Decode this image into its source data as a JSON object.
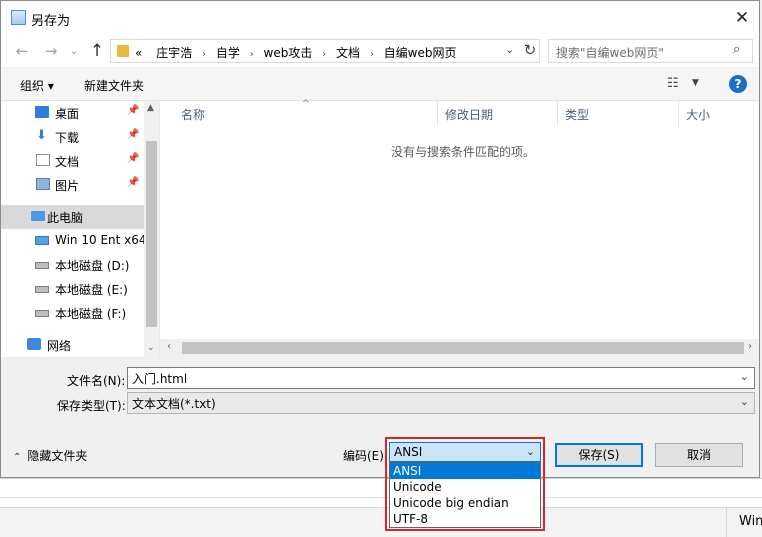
{
  "dialog": {
    "title": "另存为",
    "close_label": "✕"
  },
  "nav": {
    "back": "←",
    "forward": "→",
    "recent": "⌄",
    "up": "↑",
    "breadcrumb_prefix": "«",
    "breadcrumbs": [
      "庄宇浩",
      "自学",
      "web攻击",
      "文档",
      "自编web网页"
    ],
    "search_placeholder": "搜索\"自编web网页\""
  },
  "toolbar": {
    "organize": "组织 ▾",
    "new_folder": "新建文件夹",
    "help": "?"
  },
  "sidebar": {
    "items": [
      {
        "label": "桌面",
        "icon": "desktop-icon",
        "pinned": true
      },
      {
        "label": "下载",
        "icon": "download-icon",
        "pinned": true
      },
      {
        "label": "文档",
        "icon": "document-icon",
        "pinned": true
      },
      {
        "label": "图片",
        "icon": "pictures-icon",
        "pinned": true
      },
      {
        "label": "此电脑",
        "icon": "computer-icon",
        "selected": true
      },
      {
        "label": "Win 10 Ent x64",
        "icon": "system-drive-icon"
      },
      {
        "label": "本地磁盘 (D:)",
        "icon": "drive-icon"
      },
      {
        "label": "本地磁盘 (E:)",
        "icon": "drive-icon"
      },
      {
        "label": "本地磁盘 (F:)",
        "icon": "drive-icon"
      },
      {
        "label": "网络",
        "icon": "network-icon"
      }
    ]
  },
  "file_list": {
    "columns": [
      "名称",
      "修改日期",
      "类型",
      "大小"
    ],
    "empty_message": "没有与搜索条件匹配的项。"
  },
  "form": {
    "filename_label": "文件名(N):",
    "filename_value": "入门.html",
    "filetype_label": "保存类型(T):",
    "filetype_value": "文本文档(*.txt)"
  },
  "footer": {
    "hide_folders": "隐藏文件夹",
    "encoding_label": "编码(E):",
    "encoding_selected": "ANSI",
    "encoding_options": [
      "ANSI",
      "Unicode",
      "Unicode big endian",
      "UTF-8"
    ],
    "save_button": "保存(S)",
    "cancel_button": "取消"
  },
  "background": {
    "taskbar_text": "Win"
  },
  "colors": {
    "accent": "#0078d7",
    "highlight_box": "#d62525"
  }
}
